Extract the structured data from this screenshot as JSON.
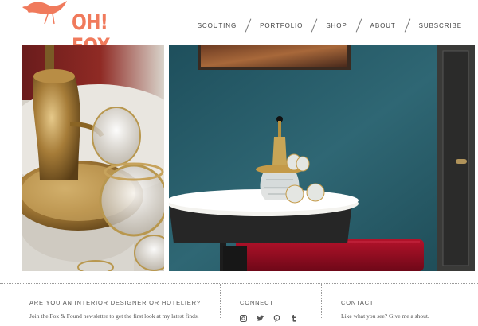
{
  "brand": {
    "name": "OH! FOX",
    "accent_color": "#f07a5c"
  },
  "nav": {
    "items": [
      {
        "label": "SCOUTING"
      },
      {
        "label": "PORTFOLIO"
      },
      {
        "label": "SHOP"
      },
      {
        "label": "ABOUT"
      },
      {
        "label": "SUBSCRIBE"
      }
    ]
  },
  "photos": [
    {
      "subject": "brass decanter and gold-rimmed glasses close-up"
    },
    {
      "subject": "decanter on marble table against teal wall"
    }
  ],
  "footer": {
    "newsletter": {
      "heading": "ARE YOU AN INTERIOR DESIGNER OR HOTELIER?",
      "text": "Join the Fox & Found newsletter to get the first look at my latest finds."
    },
    "connect": {
      "heading": "CONNECT",
      "icons": [
        "instagram-icon",
        "twitter-icon",
        "pinterest-icon",
        "tumblr-icon"
      ]
    },
    "contact": {
      "heading": "CONTACT",
      "text": "Like what you see? Give me a shout."
    }
  }
}
